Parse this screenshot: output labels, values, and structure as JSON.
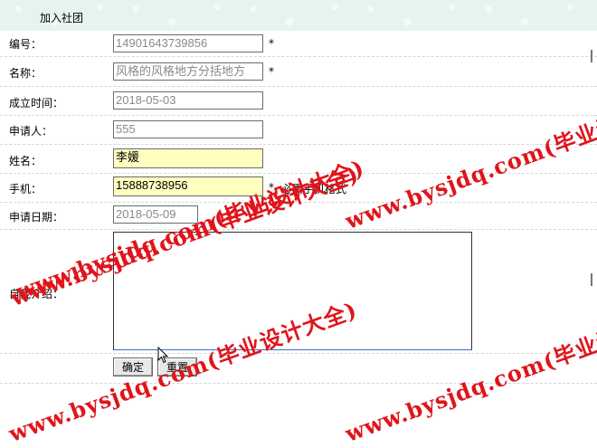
{
  "header": {
    "title": "加入社团"
  },
  "form": {
    "number": {
      "label": "编号：",
      "value": "14901643739856",
      "required": "*"
    },
    "name": {
      "label": "名称：",
      "value": "风格的风格地方分括地方",
      "required": "*"
    },
    "founded": {
      "label": "成立时间：",
      "value": "2018-05-03"
    },
    "applicant": {
      "label": "申请人：",
      "value": "555"
    },
    "fullname": {
      "label": "姓名：",
      "value": "李媛"
    },
    "phone": {
      "label": "手机：",
      "value": "15888738956",
      "required": "*",
      "hint": "必需手机格式"
    },
    "apply_date": {
      "label": "申请日期：",
      "value": "2018-05-09"
    },
    "intro": {
      "label": "自我介绍：",
      "value": ""
    }
  },
  "buttons": {
    "confirm": "确定",
    "reset": "重置"
  },
  "watermark": {
    "text_a": "www.bysjdq.com(毕业设计大全)",
    "text_b": "www.bysjdq.com(毕业设计",
    "text_c": "www.bysjdq.com(毕业设计大全)",
    "text_d": "www.bysjdq.com(毕业设计大全)",
    "text_e": "www.bysjdq.com(毕业设计大全)",
    "text_f": "www.bysjdq.com(毕业设计"
  },
  "colors": {
    "watermark": "#e0141b",
    "highlight_input": "#ffffc0",
    "header_bg": "#e6f4f1"
  }
}
